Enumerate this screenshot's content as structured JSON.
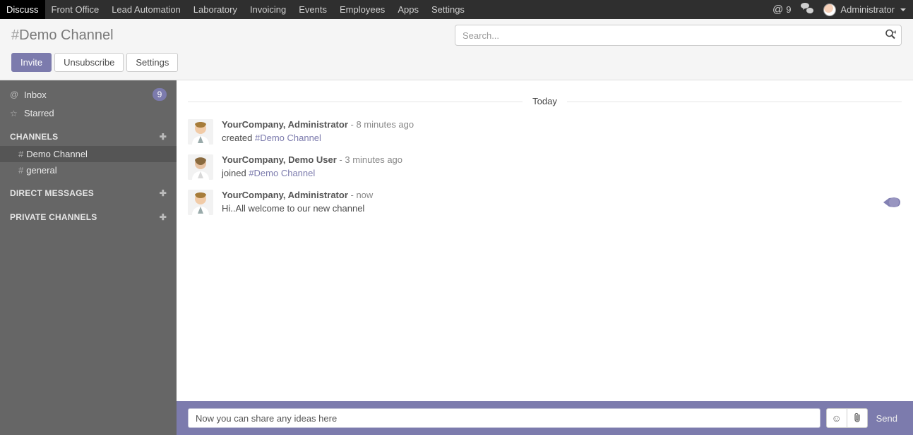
{
  "navbar": {
    "items": [
      {
        "label": "Discuss",
        "active": true
      },
      {
        "label": "Front Office"
      },
      {
        "label": "Lead Automation"
      },
      {
        "label": "Laboratory"
      },
      {
        "label": "Invoicing"
      },
      {
        "label": "Events"
      },
      {
        "label": "Employees"
      },
      {
        "label": "Apps"
      },
      {
        "label": "Settings"
      }
    ],
    "mentions": "9",
    "user": "Administrator"
  },
  "control_panel": {
    "title_hash": "#",
    "title_name": "Demo Channel",
    "search_placeholder": "Search...",
    "buttons": {
      "invite": "Invite",
      "unsubscribe": "Unsubscribe",
      "settings": "Settings"
    }
  },
  "sidebar": {
    "inbox_label": "Inbox",
    "inbox_badge": "9",
    "starred_label": "Starred",
    "sections": {
      "channels": "CHANNELS",
      "dm": "DIRECT MESSAGES",
      "private": "PRIVATE CHANNELS"
    },
    "channels": [
      {
        "name": "Demo Channel",
        "active": true
      },
      {
        "name": "general"
      }
    ]
  },
  "thread": {
    "date": "Today",
    "messages": [
      {
        "author": "YourCompany, Administrator",
        "time": "8 minutes ago",
        "body_prefix": "created ",
        "body_link": "#Demo Channel",
        "avatar_kind": "admin"
      },
      {
        "author": "YourCompany, Demo User",
        "time": "3 minutes ago",
        "body_prefix": "joined ",
        "body_link": "#Demo Channel",
        "avatar_kind": "demo"
      },
      {
        "author": "YourCompany, Administrator",
        "time": "now",
        "body_text": "Hi..All welcome to our new channel",
        "avatar_kind": "admin",
        "actions_blob": true
      }
    ]
  },
  "composer": {
    "value": "Now you can share any ideas here",
    "send": "Send"
  }
}
